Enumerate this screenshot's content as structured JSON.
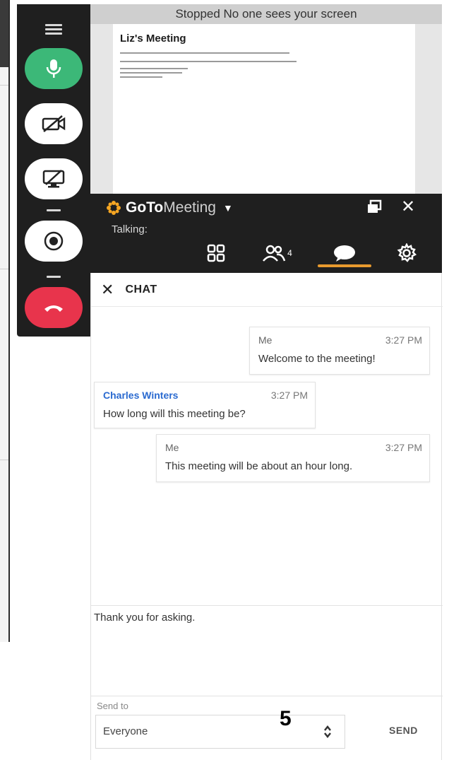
{
  "screen_share": {
    "status": "Stopped  No one sees your screen",
    "document_title": "Liz's Meeting"
  },
  "app": {
    "brand_bold": "GoTo",
    "brand_light": "Meeting",
    "talking_label": "Talking:",
    "attendee_count": "4"
  },
  "chat": {
    "title": "CHAT",
    "messages": [
      {
        "from": "Me",
        "time": "3:27 PM",
        "text": "Welcome to the meeting!"
      },
      {
        "from": "Charles Winters",
        "time": "3:27 PM",
        "text": "How long will this meeting be?"
      },
      {
        "from": "Me",
        "time": "3:27 PM",
        "text": "This meeting will be about an hour long."
      }
    ],
    "compose_value": "Thank you for asking.",
    "send_to_label": "Send to",
    "recipient": "Everyone",
    "send_label": "SEND"
  },
  "annotation": {
    "step_number": "5"
  },
  "colors": {
    "mic_active": "#3cb878",
    "leave": "#e8344c",
    "brand_orange": "#f5a623",
    "chat_tab_underline": "#e89a2e",
    "sender_link": "#2a6ad0"
  },
  "icons": {
    "menu": "hamburger-icon",
    "mic": "microphone-icon",
    "camera": "camera-off-icon",
    "screen": "screen-share-off-icon",
    "record": "record-icon",
    "leave": "hang-up-icon",
    "restore": "restore-window-icon",
    "close": "close-icon",
    "grid": "grid-view-icon",
    "attendees": "attendees-icon",
    "chat": "chat-bubble-icon",
    "settings": "gear-icon",
    "select": "up-down-chevron-icon"
  }
}
